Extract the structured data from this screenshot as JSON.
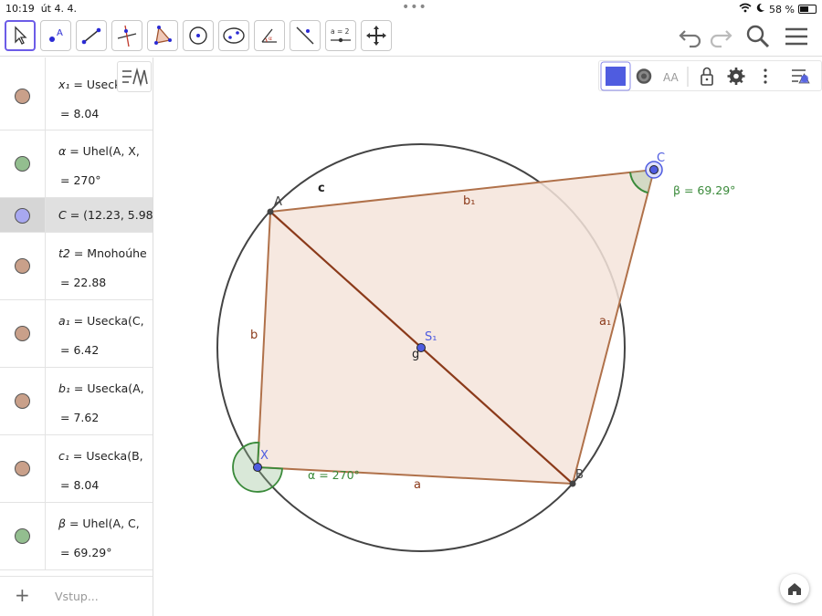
{
  "statusbar": {
    "time": "10:19",
    "date": "út 4. 4.",
    "battery_text": "58 %",
    "battery_level": 0.58
  },
  "toolbar": {
    "tools": [
      {
        "name": "move-tool",
        "selected": true
      },
      {
        "name": "point-tool",
        "label": "A"
      },
      {
        "name": "segment-tool"
      },
      {
        "name": "perpendicular-line-tool"
      },
      {
        "name": "polygon-tool"
      },
      {
        "name": "circle-center-point-tool"
      },
      {
        "name": "conic-tool"
      },
      {
        "name": "angle-tool",
        "label": "α"
      },
      {
        "name": "reflect-tool"
      },
      {
        "name": "slider-tool",
        "label": "a = 2"
      },
      {
        "name": "move-graphics-tool"
      }
    ],
    "actions": [
      "undo-icon",
      "redo-icon",
      "search-icon",
      "menu-icon"
    ]
  },
  "algebra": {
    "rows": [
      {
        "def_name": "x₁",
        "def_rhs": "Usecka(",
        "value": "8.04",
        "color": "#c9a08a"
      },
      {
        "def_name": "α",
        "def_rhs": "Uhel(A, X,",
        "value": "270°",
        "color": "#93be8f"
      },
      {
        "def_name": "C",
        "def_rhs": "(12.23, 5.98)",
        "value": "",
        "color": "#a8a8f0",
        "selected": true
      },
      {
        "def_name": "t2",
        "def_rhs": "Mnohoúhe",
        "value": "22.88",
        "color": "#c9a08a"
      },
      {
        "def_name": "a₁",
        "def_rhs": "Usecka(C,",
        "value": "6.42",
        "color": "#c9a08a"
      },
      {
        "def_name": "b₁",
        "def_rhs": "Usecka(A,",
        "value": "7.62",
        "color": "#c9a08a"
      },
      {
        "def_name": "c₁",
        "def_rhs": "Usecka(B,",
        "value": "8.04",
        "color": "#c9a08a"
      },
      {
        "def_name": "β",
        "def_rhs": "Uhel(A, C,",
        "value": "69.29°",
        "color": "#93be8f"
      }
    ],
    "input_placeholder": "Vstup..."
  },
  "graphics": {
    "points": {
      "A": "A",
      "B": "B",
      "C": "C",
      "X": "X",
      "S": "S₁"
    },
    "segment_labels": {
      "a": "a",
      "b": "b",
      "a1": "a₁",
      "b1": "b₁",
      "g": "g",
      "c": "c"
    },
    "angles": {
      "alpha": "α = 270°",
      "beta": "β = 69.29°"
    },
    "colors": {
      "polygon_fill": "#f5e4db",
      "polygon_stroke": "#b0714a",
      "diagonal": "#8b3a1a",
      "circle": "#444444",
      "angle": "#3a8a3a",
      "point_blue": "#4f5ce0"
    }
  },
  "style_bar": {
    "color_swatch": "#4f5ce0",
    "aa_label": "AA"
  }
}
